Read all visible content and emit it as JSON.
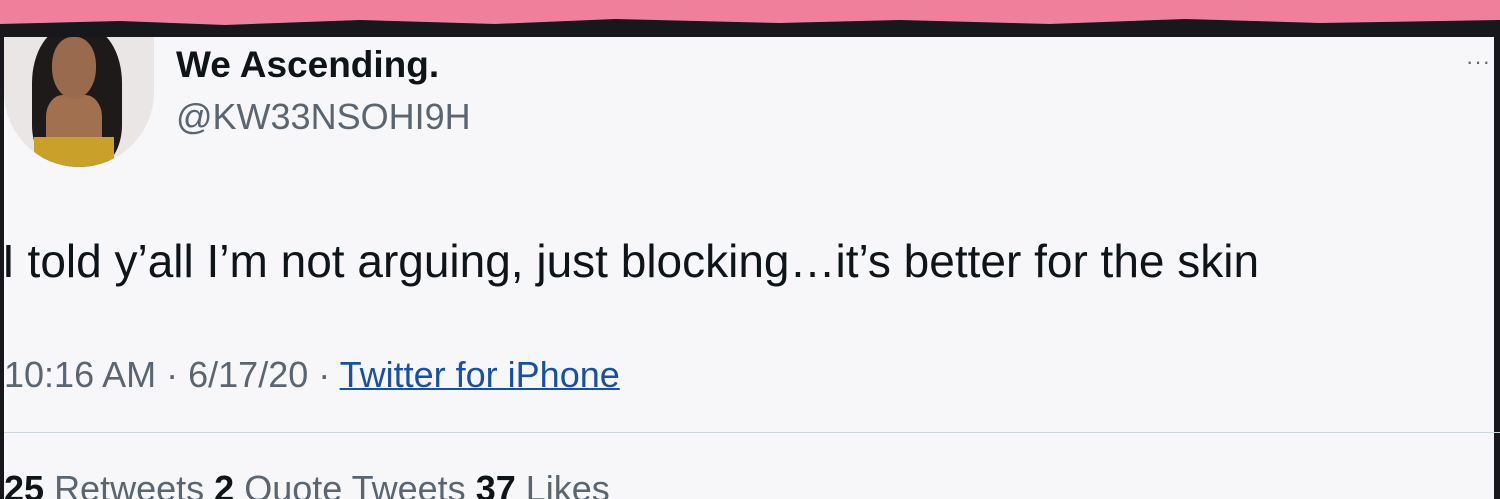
{
  "tweet": {
    "display_name": "We Ascending.",
    "handle": "@KW33NSOHI9H",
    "text": "I told y’all I’m not arguing, just blocking…it’s better for the skin",
    "time": "10:16 AM",
    "separator": "·",
    "date": "6/17/20",
    "source": "Twitter for iPhone",
    "more_icon": "more-horizontal-icon"
  },
  "stats": {
    "retweets_count": "25",
    "retweets_label": "Retweets",
    "quote_tweets_count": "2",
    "quote_tweets_label": "Quote Tweets",
    "likes_count": "37",
    "likes_label": "Likes"
  },
  "colors": {
    "background_border": "#f07f9c",
    "frame": "#17171c",
    "card": "#f7f7f9",
    "link": "#1b4fa0",
    "text": "#0f1419",
    "secondary_text": "#5b6570"
  }
}
